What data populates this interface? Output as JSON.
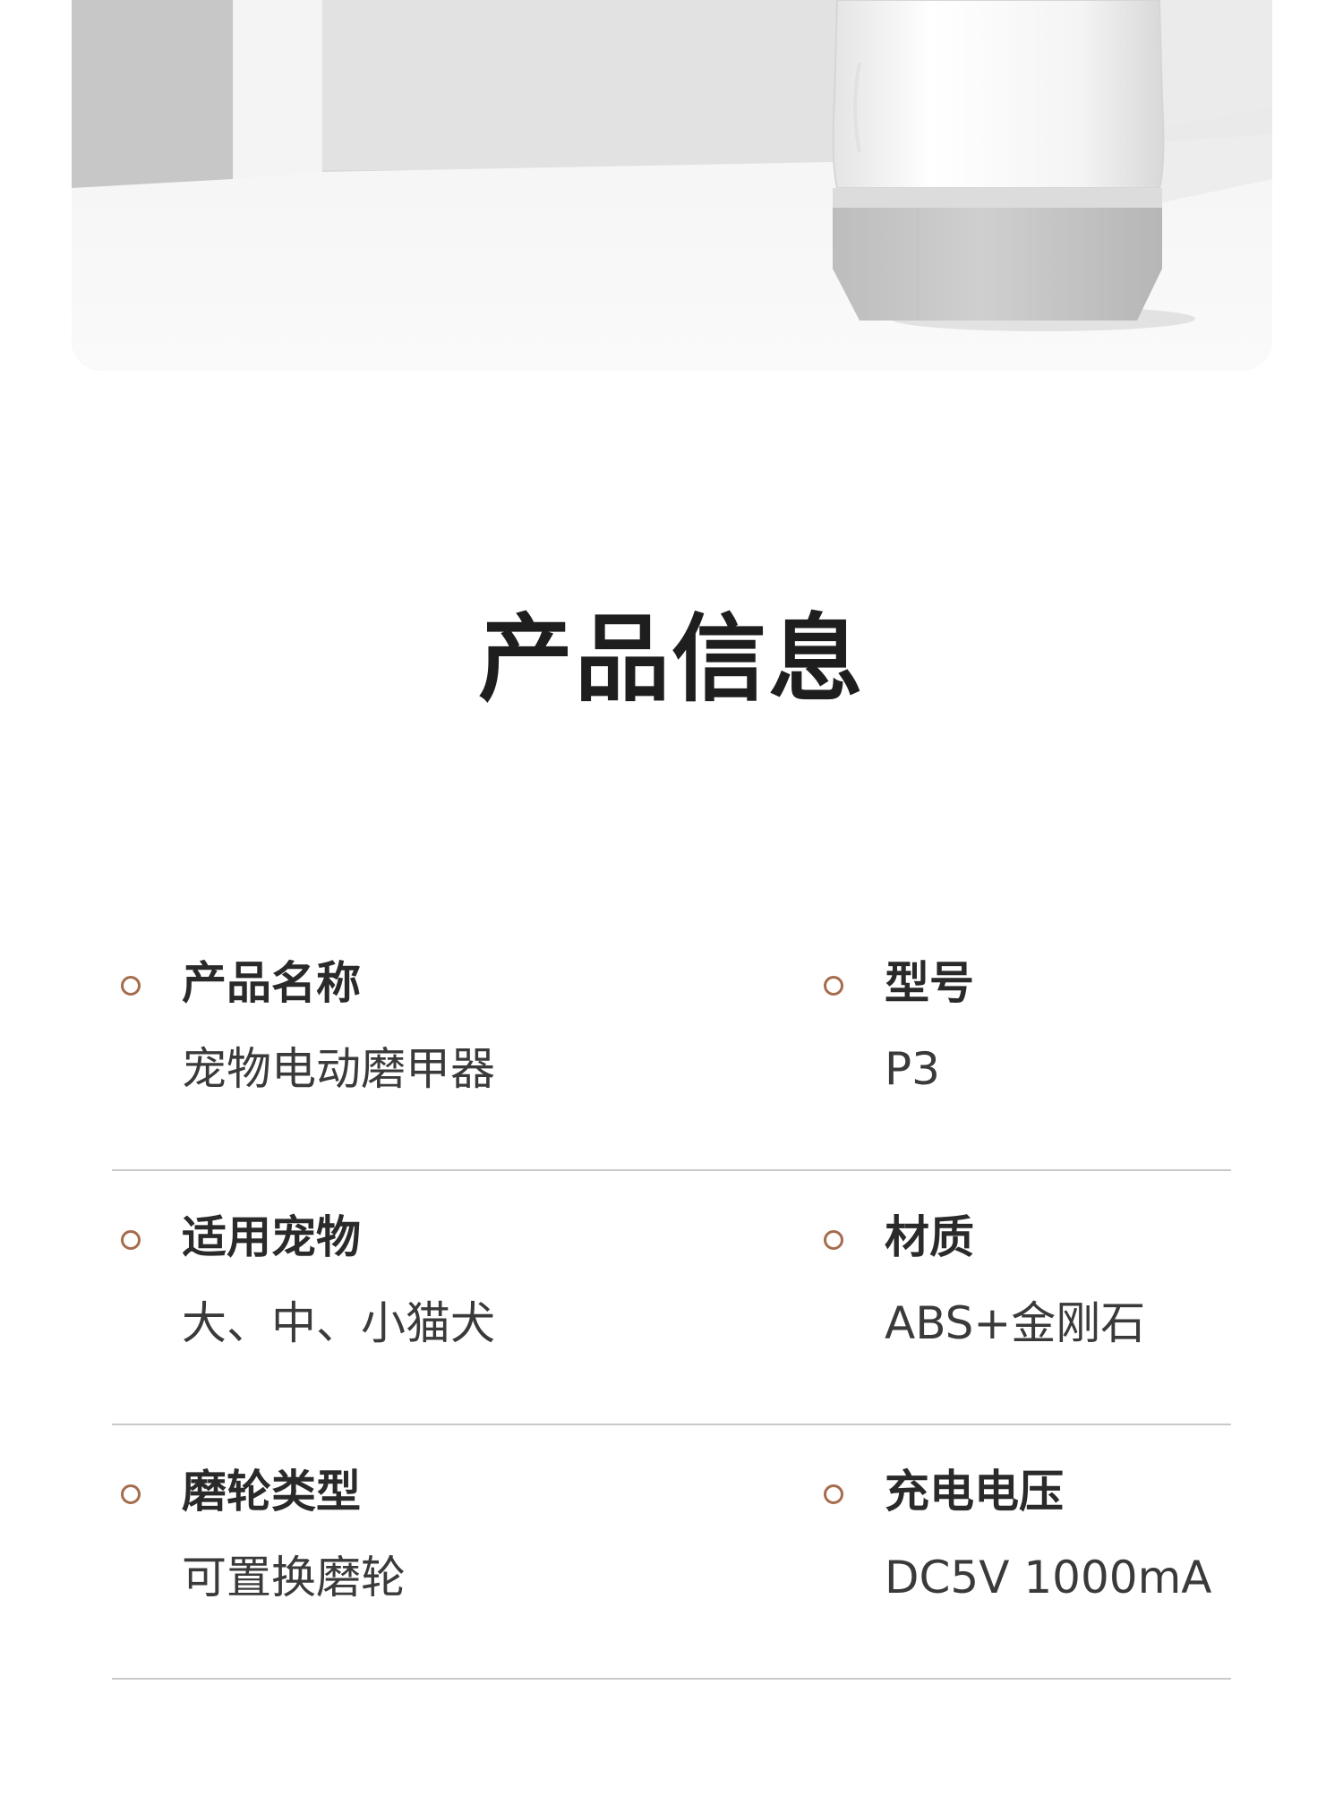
{
  "section": {
    "title": "产品信息"
  },
  "specs": [
    {
      "left": {
        "label": "产品名称",
        "value": "宠物电动磨甲器"
      },
      "right": {
        "label": "型号",
        "value": "P3"
      }
    },
    {
      "left": {
        "label": "适用宠物",
        "value": "大、中、小猫犬"
      },
      "right": {
        "label": "材质",
        "value": "ABS+金刚石"
      }
    },
    {
      "left": {
        "label": "磨轮类型",
        "value": "可置换磨轮"
      },
      "right": {
        "label": "充电电压",
        "value": "DC5V 1000mA"
      }
    }
  ],
  "colors": {
    "accent_bullet": "#a66c4c",
    "divider": "#c9c9c9",
    "title": "#1e1e1e"
  }
}
